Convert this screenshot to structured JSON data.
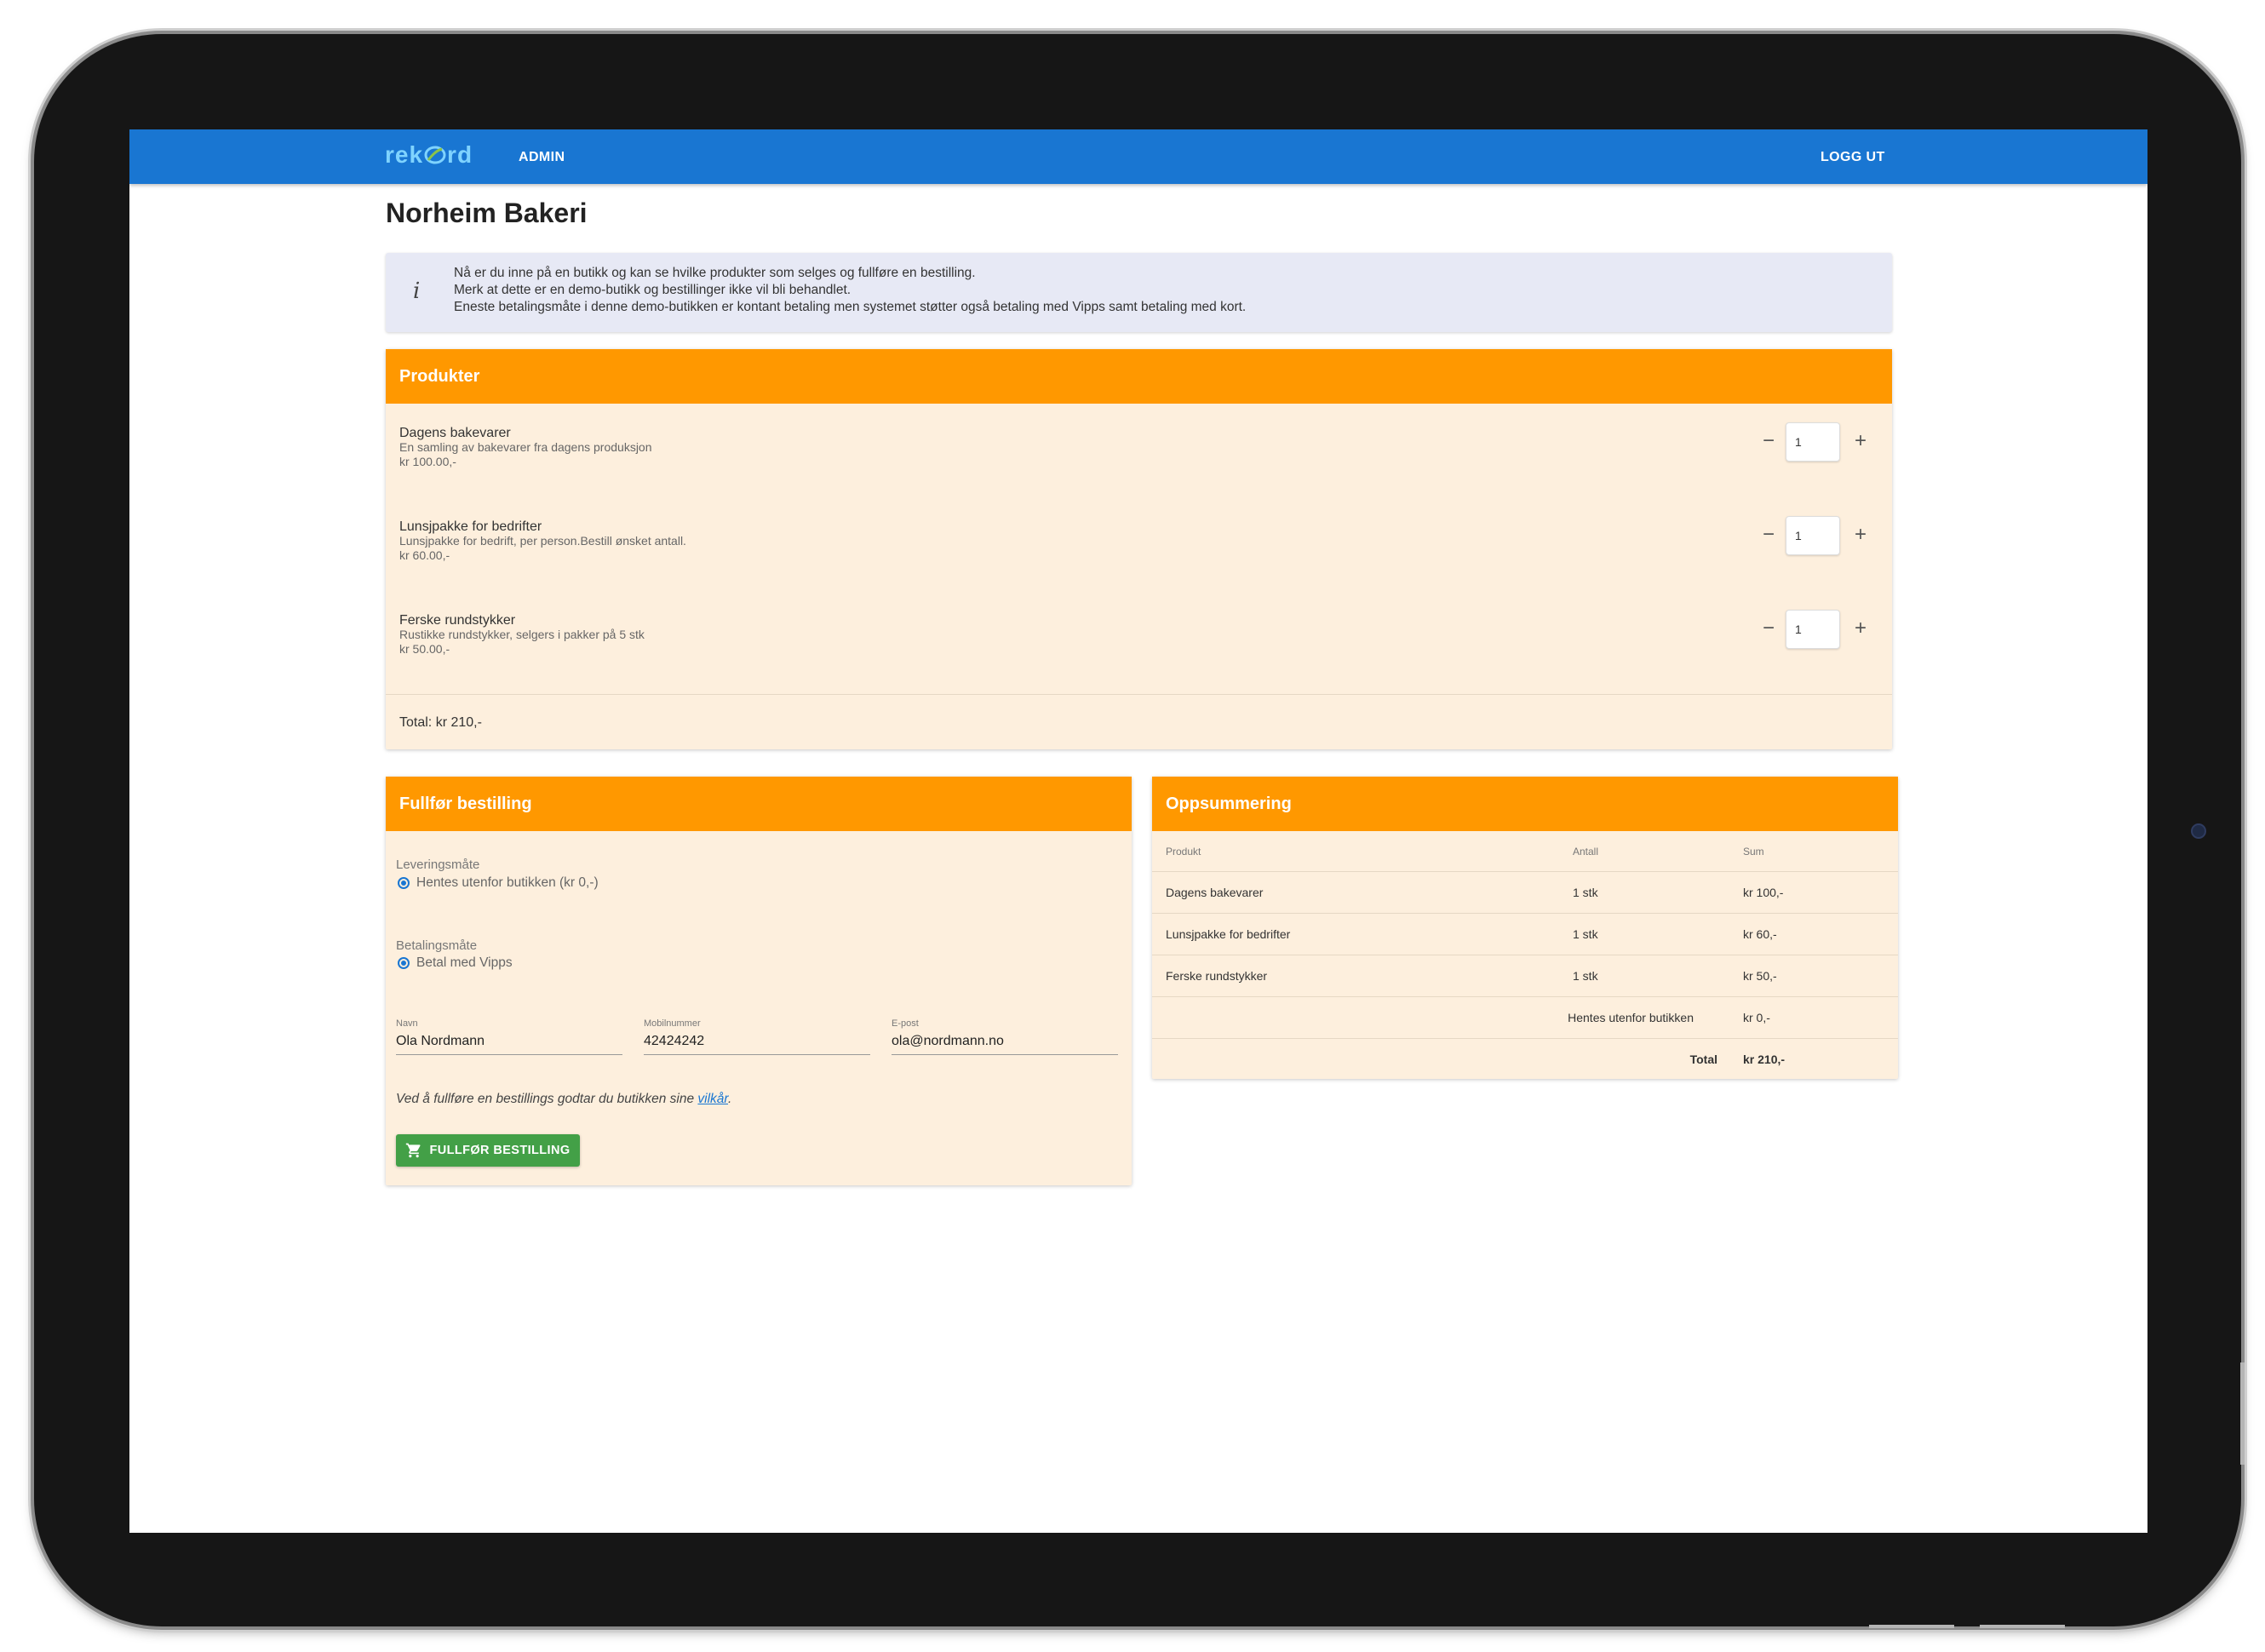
{
  "header": {
    "logo_text": "rekord",
    "admin_label": "ADMIN",
    "logout_label": "LOGG UT"
  },
  "page_title": "Norheim Bakeri",
  "info": {
    "icon": "info-icon",
    "line1": "Nå er du inne på en butikk og kan se hvilke produkter som selges og fullføre en bestilling.",
    "line2": "Merk at dette er en demo-butikk og bestillinger ikke vil bli behandlet.",
    "line3": "Eneste betalingsmåte i denne demo-butikken er kontant betaling men systemet støtter også betaling med Vipps samt betaling med kort."
  },
  "products": {
    "title": "Produkter",
    "items": [
      {
        "name": "Dagens bakevarer",
        "description": "En samling av bakevarer fra dagens produksjon",
        "price": "kr 100.00,-",
        "quantity": "1"
      },
      {
        "name": "Lunsjpakke for bedrifter",
        "description": "Lunsjpakke for bedrift, per person.Bestill ønsket antall.",
        "price": "kr 60.00,-",
        "quantity": "1"
      },
      {
        "name": "Ferske rundstykker",
        "description": "Rustikke rundstykker, selgers i pakker på 5 stk",
        "price": "kr 50.00,-",
        "quantity": "1"
      }
    ],
    "total": "Total: kr 210,-"
  },
  "checkout": {
    "title": "Fullfør bestilling",
    "delivery_label": "Leveringsmåte",
    "delivery_option": "Hentes utenfor butikken (kr 0,-)",
    "payment_label": "Betalingsmåte",
    "payment_option": "Betal med Vipps",
    "name_label": "Navn",
    "name_value": "Ola Nordmann",
    "mobile_label": "Mobilnummer",
    "mobile_value": "42424242",
    "email_label": "E-post",
    "email_value": "ola@nordmann.no",
    "terms_text": "Ved å fullføre en bestillings godtar du butikken sine ",
    "terms_link": "vilkår",
    "terms_end": ".",
    "submit_label": "FULLFØR BESTILLING"
  },
  "summary": {
    "title": "Oppsummering",
    "columns": [
      "Produkt",
      "Antall",
      "Sum"
    ],
    "rows": [
      [
        "Dagens bakevarer",
        "1 stk",
        "kr 100,-"
      ],
      [
        "Lunsjpakke for bedrifter",
        "1 stk",
        "kr 60,-"
      ],
      [
        "Ferske rundstykker",
        "1 stk",
        "kr 50,-"
      ],
      [
        "",
        "Hentes utenfor butikken",
        "kr 0,-"
      ],
      [
        "",
        "Total",
        "kr 210,-"
      ]
    ]
  },
  "colors": {
    "appbar": "#1976d2",
    "card_header": "#ff9800",
    "card_body": "#fdefdd",
    "submit": "#43a047"
  }
}
